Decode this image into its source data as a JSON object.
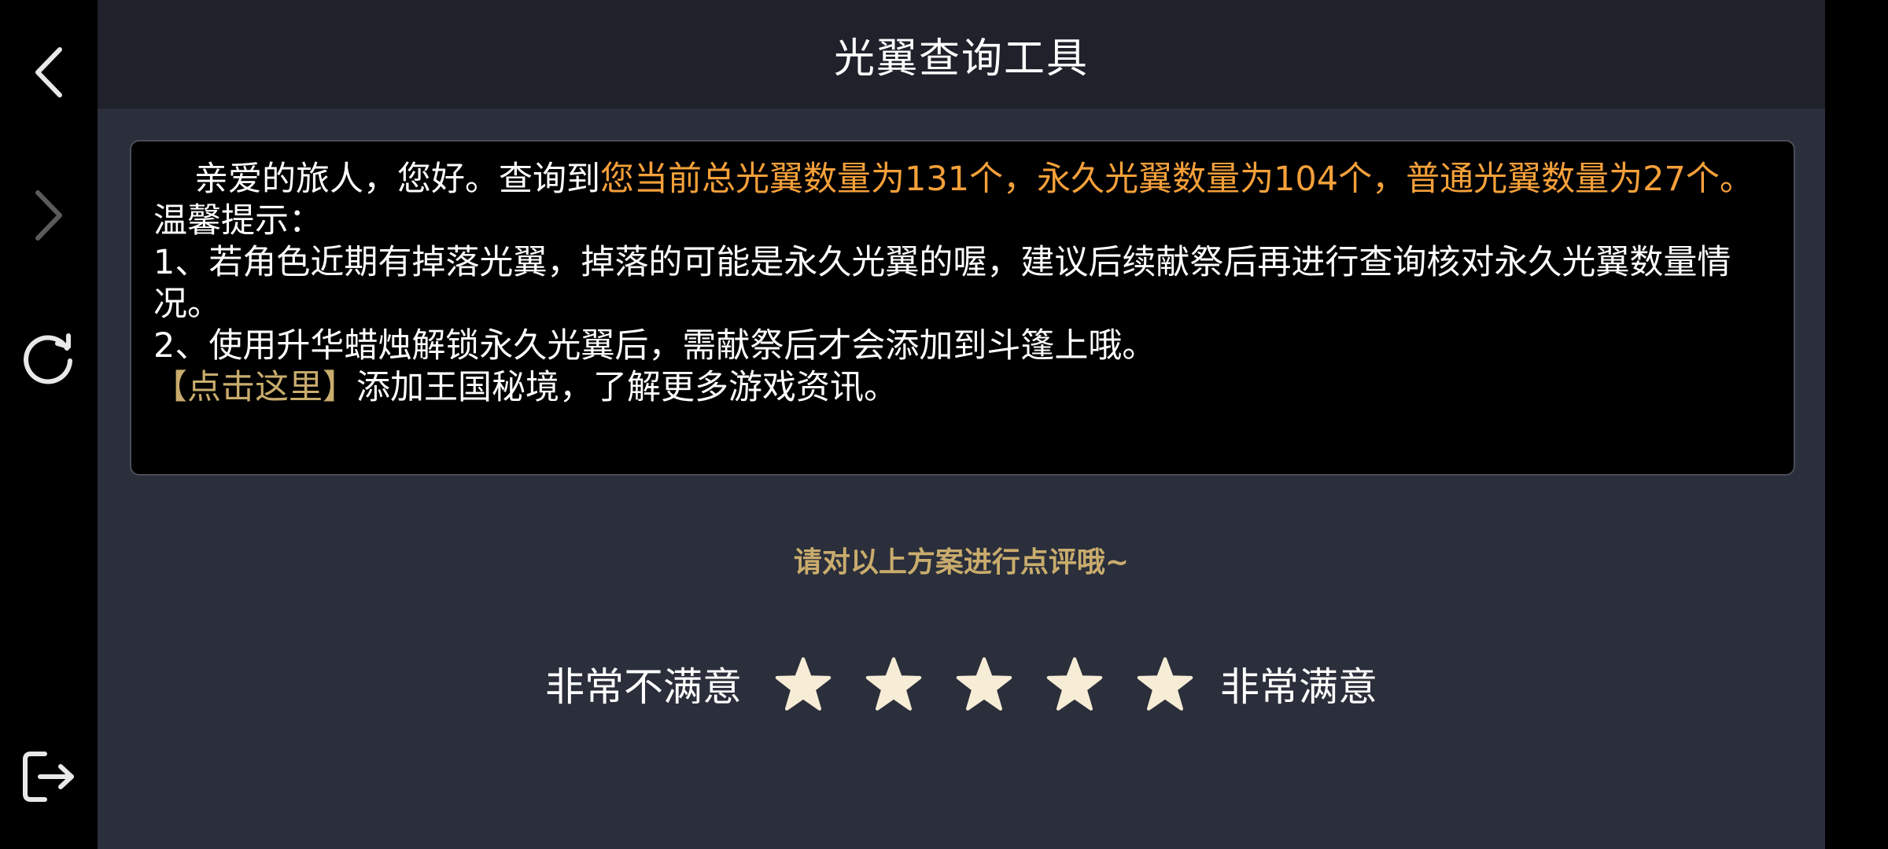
{
  "header": {
    "title": "光翼查询工具"
  },
  "nav": {
    "icons": [
      "back-arrow-icon",
      "forward-arrow-icon",
      "refresh-icon",
      "exit-icon"
    ]
  },
  "message": {
    "greeting": "亲爱的旅人，您好。查询到",
    "result": "您当前总光翼数量为131个，永久光翼数量为104个，普通光翼数量为27个。",
    "tips_title": "温馨提示：",
    "tip1": "1、若角色近期有掉落光翼，掉落的可能是永久光翼的喔，建议后续献祭后再进行查询核对永久光翼数量情况。",
    "tip2": "2、使用升华蜡烛解锁永久光翼后，需献祭后才会添加到斗篷上哦。",
    "link_text": "【点击这里】",
    "link_suffix": "添加王国秘境，了解更多游戏资讯。"
  },
  "rating": {
    "prompt": "请对以上方案进行点评哦~",
    "low_label": "非常不满意",
    "high_label": "非常满意",
    "star_count": 5,
    "star_color": "#f7ecd6"
  },
  "colors": {
    "highlight": "#f5a03a",
    "gold": "#c9ac6d",
    "panel": "#2b2f3b",
    "titlebar": "#1f222b"
  }
}
